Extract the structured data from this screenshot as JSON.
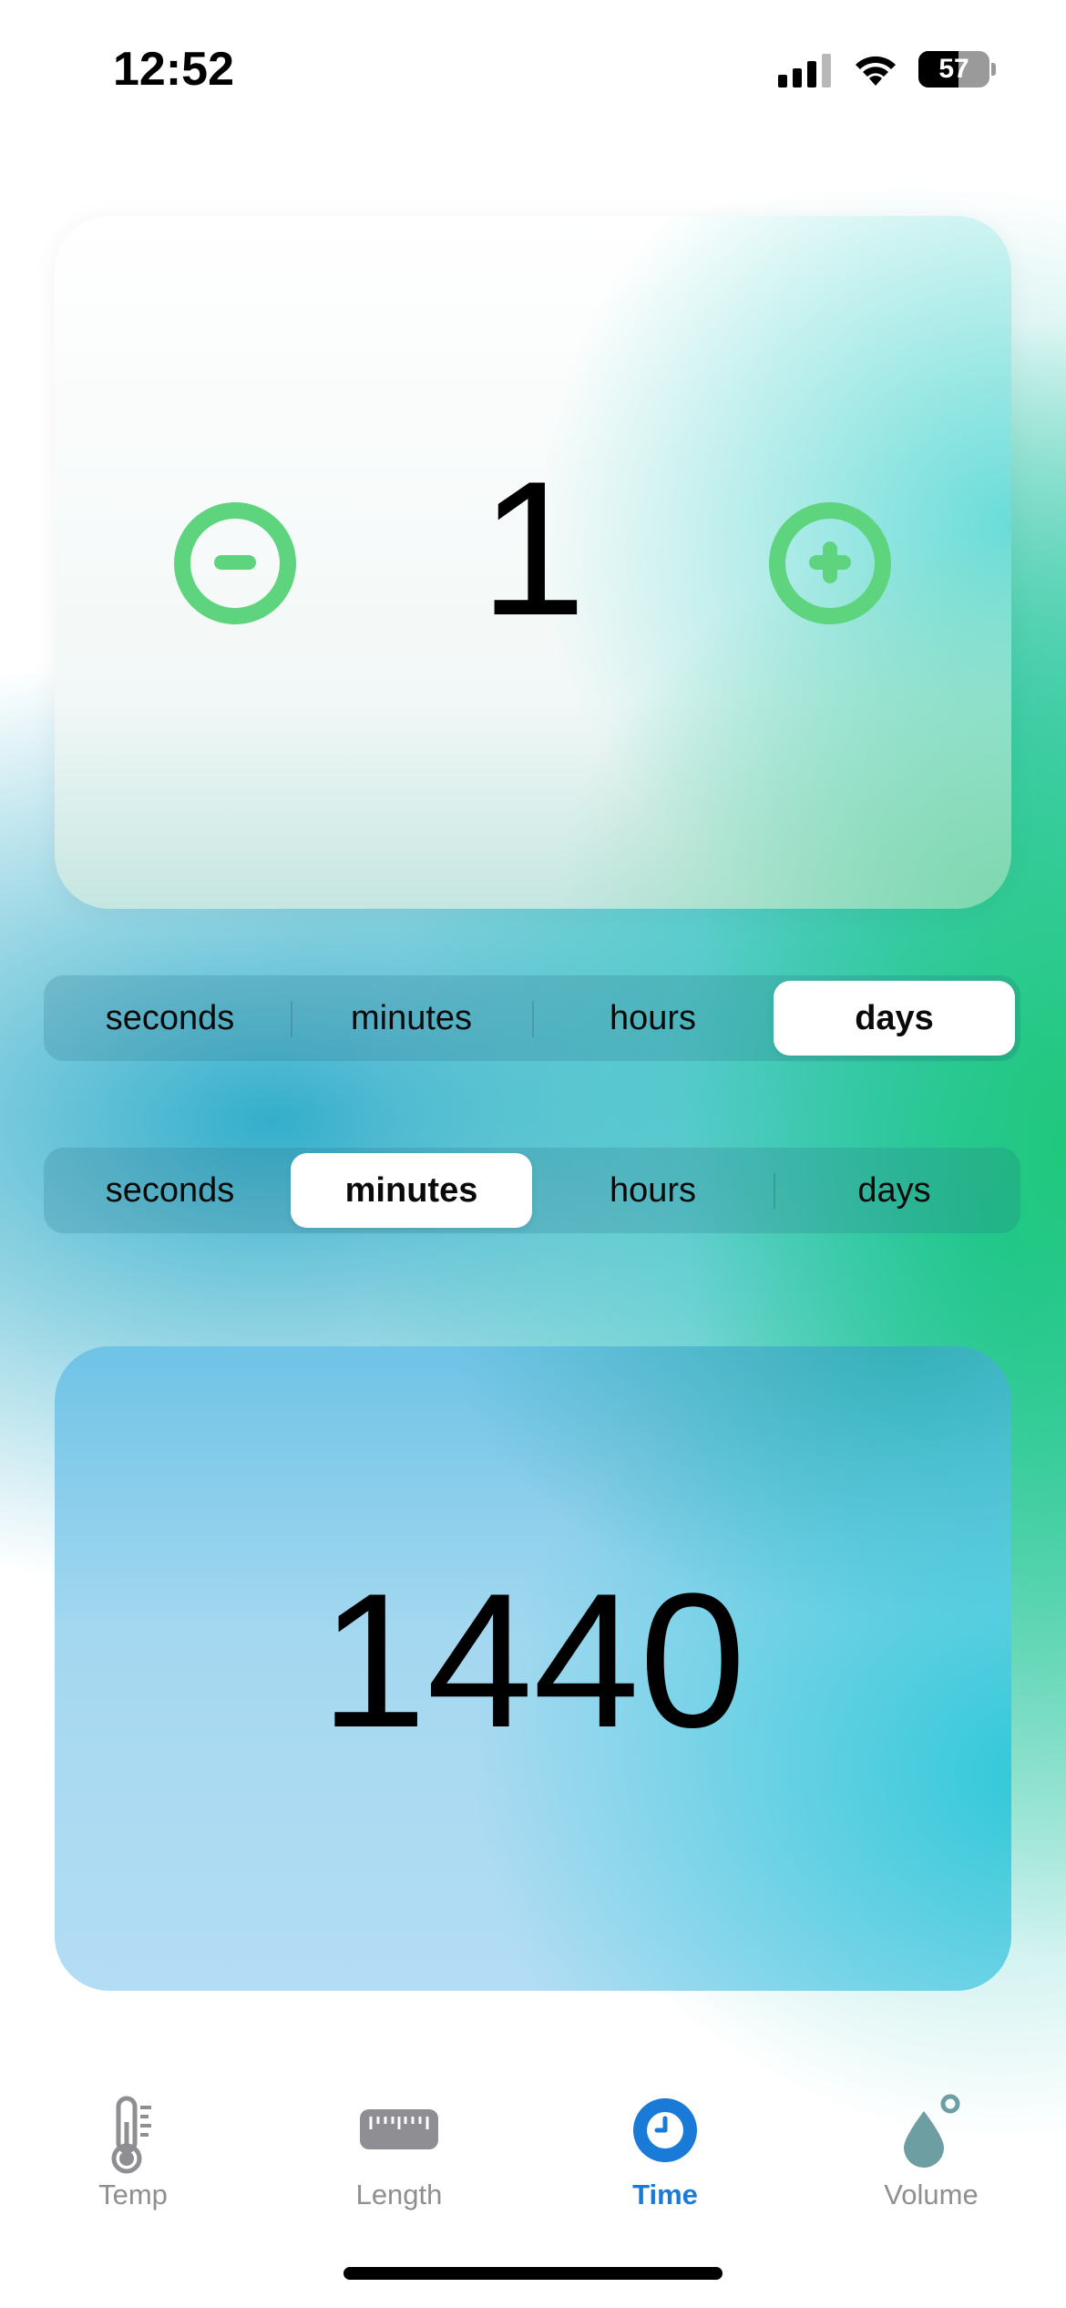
{
  "status_bar": {
    "time": "12:52",
    "battery_percent": "57"
  },
  "converter": {
    "input_value": "1",
    "output_value": "1440",
    "accent_color": "#5fd47f"
  },
  "from_units": {
    "options": [
      "seconds",
      "minutes",
      "hours",
      "days"
    ],
    "selected": "days"
  },
  "to_units": {
    "options": [
      "seconds",
      "minutes",
      "hours",
      "days"
    ],
    "selected": "minutes"
  },
  "tabbar": {
    "active_color": "#1a7ad8",
    "tabs": [
      {
        "label": "Temp",
        "icon": "thermometer-icon",
        "active": false
      },
      {
        "label": "Length",
        "icon": "ruler-icon",
        "active": false
      },
      {
        "label": "Time",
        "icon": "clock-icon",
        "active": true
      },
      {
        "label": "Volume",
        "icon": "drop-icon",
        "active": false
      }
    ]
  }
}
